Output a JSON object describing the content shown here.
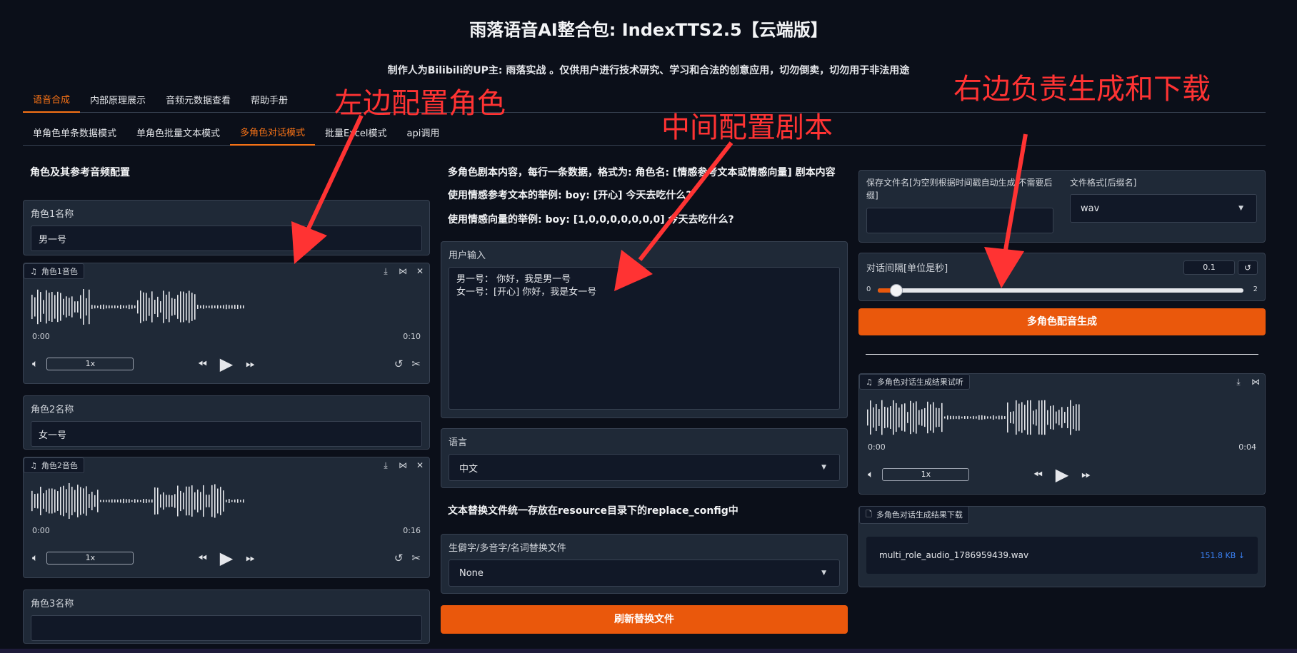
{
  "app_title": "雨落语音AI整合包: IndexTTS2.5【云端版】",
  "subtitle": "制作人为Bilibili的UP主: 雨落实战 。仅供用户进行技术研究、学习和合法的创意应用，切勿倒卖，切勿用于非法用途",
  "main_tabs": [
    "语音合成",
    "内部原理展示",
    "音频元数据查看",
    "帮助手册"
  ],
  "sub_tabs": [
    "单角色单条数据模式",
    "单角色批量文本模式",
    "多角色对话模式",
    "批量Excel模式",
    "api调用"
  ],
  "left": {
    "section_title": "角色及其参考音频配置",
    "role1_label": "角色1名称",
    "role1_value": "男一号",
    "role1_audio_label": "角色1音色",
    "role1_time_start": "0:00",
    "role1_time_end": "0:10",
    "role2_label": "角色2名称",
    "role2_value": "女一号",
    "role2_audio_label": "角色2音色",
    "role2_time_start": "0:00",
    "role2_time_end": "0:16",
    "role3_label": "角色3名称",
    "speed_label": "1x"
  },
  "middle": {
    "desc1": "多角色剧本内容，每行一条数据，格式为: 角色名: [情感参考文本或情感向量] 剧本内容",
    "desc2": "使用情感参考文本的举例: boy: [开心] 今天去吃什么?",
    "desc3": "使用情感向量的举例: boy: [1,0,0,0,0,0,0,0] 今天去吃什么?",
    "user_input_label": "用户输入",
    "user_input_line1": "男一号：  你好，我是男一号",
    "user_input_line2": "女一号：[开心] 你好，我是女一号",
    "language_label": "语言",
    "language_value": "中文",
    "replace_note": "文本替换文件统一存放在resource目录下的replace_config中",
    "replace_file_label": "生僻字/多音字/名词替换文件",
    "replace_file_value": "None",
    "refresh_button": "刷新替换文件"
  },
  "right": {
    "save_name_label": "保存文件名[为空则根据时间戳自动生成,不需要后缀]",
    "format_label": "文件格式[后缀名]",
    "format_value": "wav",
    "interval_label": "对话间隔[单位是秒]",
    "interval_value": "0.1",
    "slider_min": "0",
    "slider_max": "2",
    "slider_level": 0.05,
    "generate_button": "多角色配音生成",
    "result_audio_label": "多角色对话生成结果试听",
    "result_time_start": "0:00",
    "result_time_end": "0:04",
    "download_label": "多角色对话生成结果下载",
    "download_file": "multi_role_audio_1786959439.wav",
    "download_size": "151.8 KB ↓"
  },
  "annotations": {
    "left": "左边配置角色",
    "middle": "中间配置剧本",
    "right": "右边负责生成和下载"
  },
  "colors": {
    "accent": "#ea580c",
    "annotation": "#ff3333",
    "background": "#0b0f19"
  }
}
